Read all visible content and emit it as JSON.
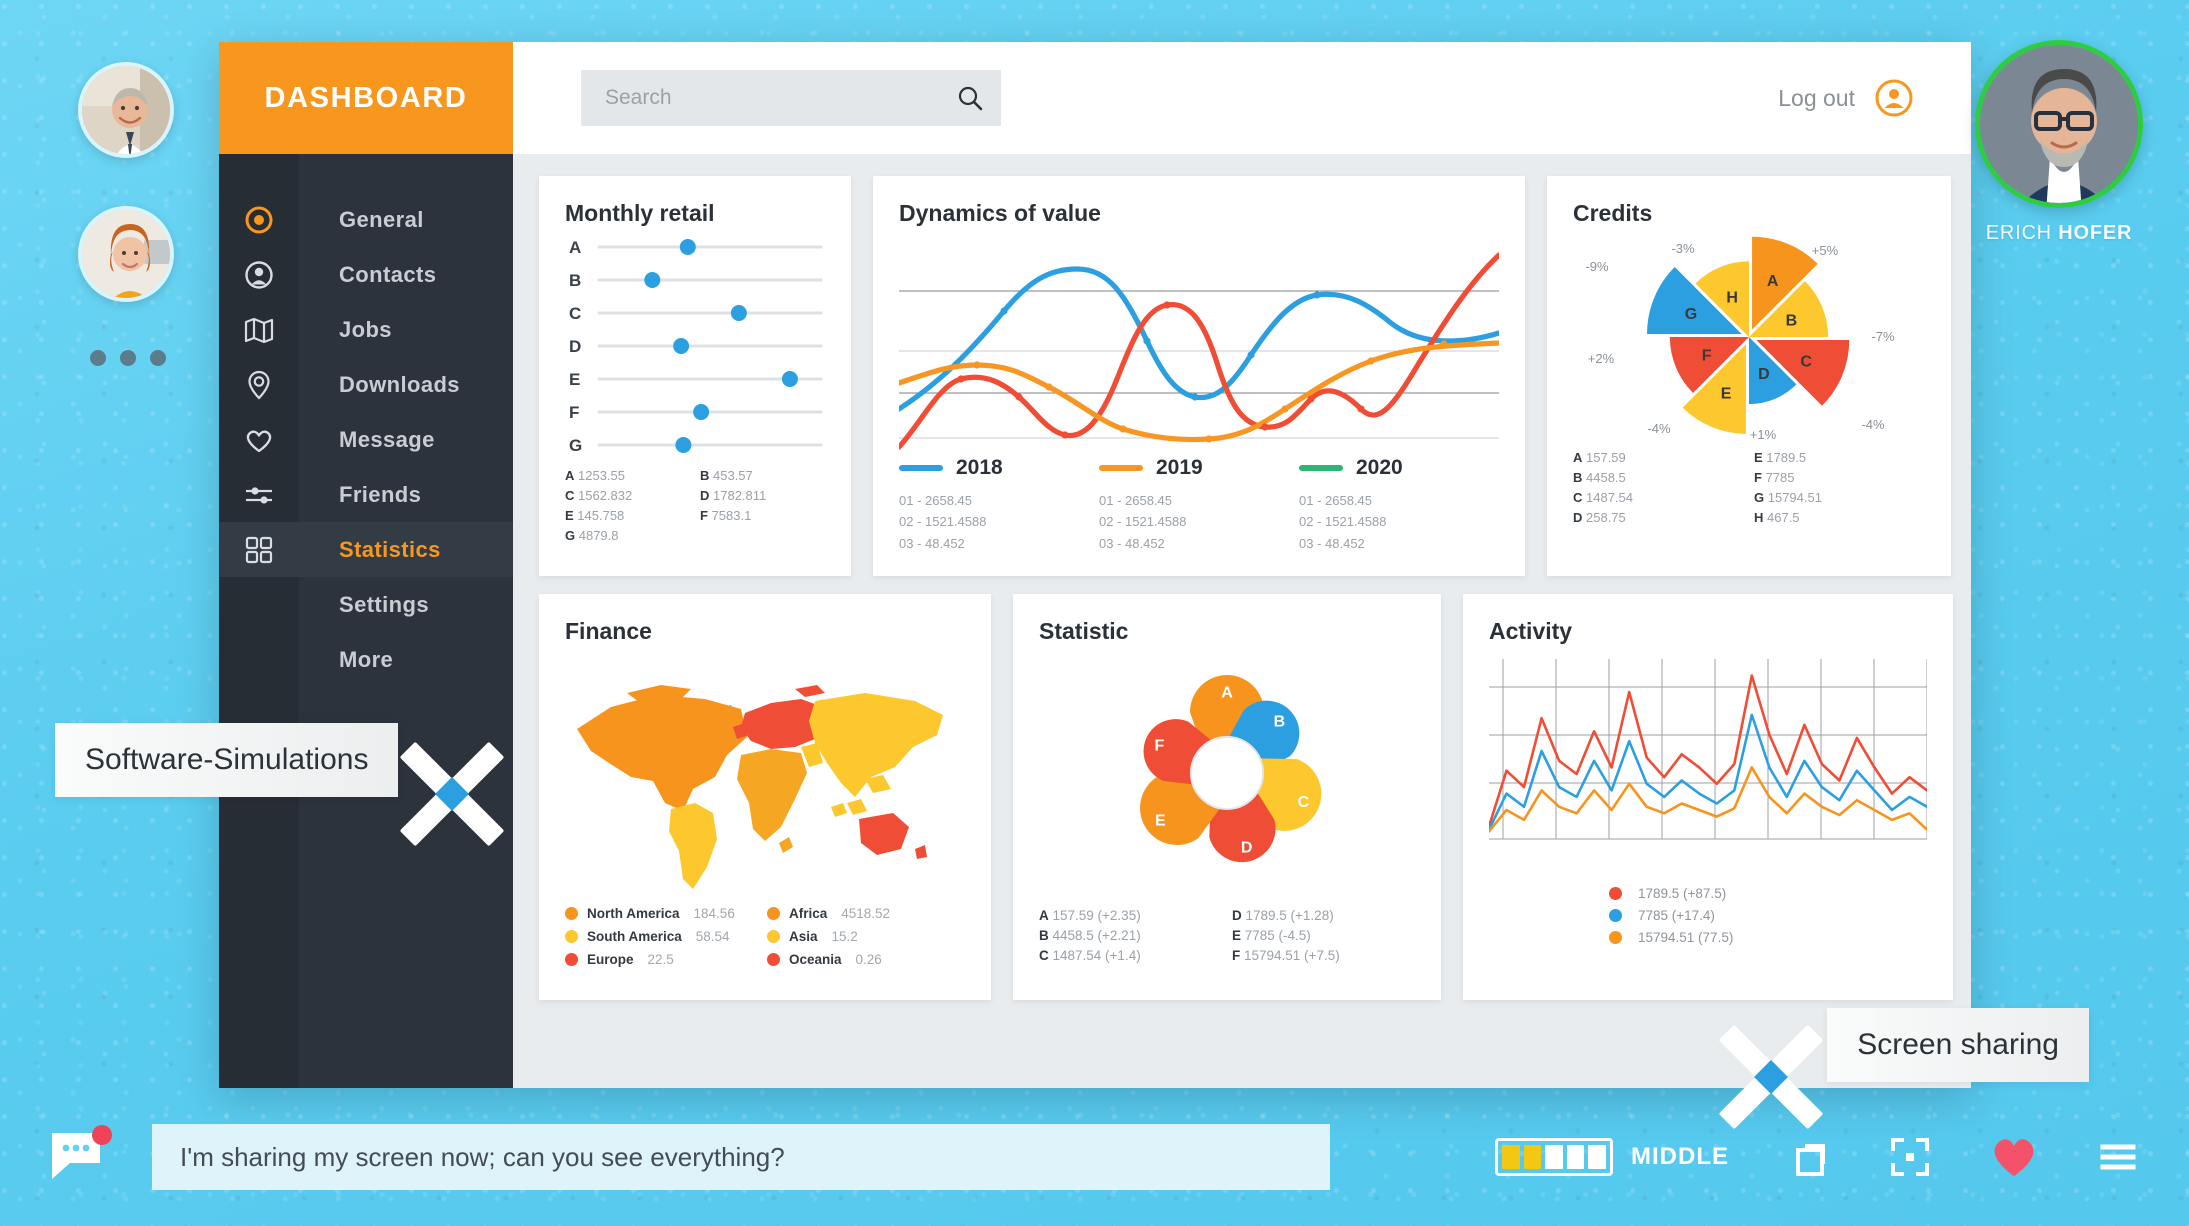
{
  "brand": {
    "title": "DASHBOARD"
  },
  "search": {
    "placeholder": "Search",
    "value": "",
    "icon": "search-icon"
  },
  "header": {
    "logout_label": "Log out",
    "user_icon": "user-circle-icon"
  },
  "sidebar": {
    "items": [
      {
        "label": "General",
        "icon": "target-icon",
        "active": false
      },
      {
        "label": "Contacts",
        "icon": "contact-icon",
        "active": false
      },
      {
        "label": "Jobs",
        "icon": "map-icon",
        "active": false
      },
      {
        "label": "Downloads",
        "icon": "pin-icon",
        "active": false
      },
      {
        "label": "Message",
        "icon": "heart-icon",
        "active": false
      },
      {
        "label": "Friends",
        "icon": "slider-icon",
        "active": false
      },
      {
        "label": "Statistics",
        "icon": "grid-icon",
        "active": true
      },
      {
        "label": "Settings",
        "icon": "",
        "active": false
      },
      {
        "label": "More",
        "icon": "",
        "active": false
      }
    ]
  },
  "participants": {
    "avatars": [
      {
        "name": "participant-1"
      },
      {
        "name": "participant-2"
      }
    ],
    "more_dots": 3
  },
  "speaker": {
    "first_name": "ERICH",
    "last_name": "HOFER",
    "ring_color": "#2ecc40"
  },
  "annotations": [
    {
      "label": "Software-Simulations"
    },
    {
      "label": "Screen sharing"
    }
  ],
  "chat": {
    "message": "I'm sharing my screen now; can you see everything?",
    "badge": true
  },
  "controls": {
    "quality_label": "MIDDLE",
    "quality_filled": 2,
    "quality_total": 5,
    "buttons": [
      {
        "name": "windows-icon"
      },
      {
        "name": "fullscreen-icon"
      },
      {
        "name": "heart-icon"
      },
      {
        "name": "menu-icon"
      }
    ]
  },
  "colors": {
    "accent": "#f8971d",
    "blue": "#2c9fe0",
    "orange": "#f79622",
    "red": "#ef4d35",
    "yellow": "#fdc72e",
    "green": "#2ecc40",
    "dark": "#2c333c"
  },
  "chart_data": [
    {
      "id": "monthly-retail",
      "type": "scatter",
      "title": "Monthly retail",
      "categories": [
        "A",
        "B",
        "C",
        "D",
        "E",
        "F",
        "G"
      ],
      "positions_pct": [
        40,
        24,
        63,
        37,
        86,
        46,
        38
      ],
      "values": [
        1253.55,
        453.57,
        1562.832,
        1782.811,
        145.758,
        7583.1,
        4879.8
      ],
      "legend": [
        {
          "key": "A",
          "value": "1253.55"
        },
        {
          "key": "B",
          "value": "453.57"
        },
        {
          "key": "C",
          "value": "1562.832"
        },
        {
          "key": "D",
          "value": "1782.811"
        },
        {
          "key": "E",
          "value": "145.758"
        },
        {
          "key": "F",
          "value": "7583.1"
        },
        {
          "key": "G",
          "value": "4879.8"
        }
      ],
      "grid": true,
      "xlabel": "",
      "ylabel": ""
    },
    {
      "id": "dynamics-of-value",
      "type": "line",
      "title": "Dynamics of value",
      "series": [
        {
          "name": "2018",
          "color": "#2c9fe0",
          "values": [
            12,
            30,
            62,
            83,
            88,
            70,
            44,
            22,
            18,
            30,
            52,
            71,
            74,
            70,
            60,
            57
          ],
          "points": [
            "01 - 2658.45",
            "02 - 1521.4588",
            "03 - 48.452"
          ]
        },
        {
          "name": "2019",
          "color": "#f79622",
          "values": [
            45,
            52,
            53,
            50,
            44,
            35,
            26,
            14,
            10,
            12,
            18,
            30,
            43,
            50,
            53,
            54
          ],
          "points": [
            "01 - 2658.45",
            "02 - 1521.4588",
            "03 - 48.452"
          ]
        },
        {
          "name": "2020",
          "color": "#2bb673",
          "values": [],
          "points": [
            "01 - 2658.45",
            "02 - 1521.4588",
            "03 - 48.452"
          ]
        }
      ],
      "extra_series": {
        "name": "red-trend",
        "color": "#ef4d35",
        "values": [
          2,
          24,
          47,
          50,
          36,
          22,
          20,
          36,
          68,
          80,
          76,
          44,
          18,
          16,
          26,
          52,
          95
        ]
      },
      "grid": true,
      "legend_position": "bottom"
    },
    {
      "id": "credits",
      "type": "pie",
      "title": "Credits",
      "slices": [
        {
          "key": "A",
          "pct_label": "+5%",
          "value": "157.59",
          "color": "#f7941e",
          "exploded": true,
          "radius": 108
        },
        {
          "key": "B",
          "pct_label": "-7%",
          "value": "4458.5",
          "color": "#fdc72e",
          "exploded": false,
          "radius": 92
        },
        {
          "key": "C",
          "pct_label": "-4%",
          "value": "1487.54",
          "color": "#ef4d35",
          "exploded": true,
          "radius": 108
        },
        {
          "key": "D",
          "pct_label": "+1%",
          "value": "258.75",
          "color": "#2c9fe0",
          "exploded": false,
          "radius": 78
        },
        {
          "key": "E",
          "pct_label": "-4%",
          "value": "1789.5",
          "color": "#fdc72e",
          "exploded": true,
          "radius": 104
        },
        {
          "key": "F",
          "pct_label": "+2%",
          "value": "7785",
          "color": "#ef4d35",
          "exploded": false,
          "radius": 92
        },
        {
          "key": "G",
          "pct_label": "-9%",
          "value": "15794.51",
          "color": "#2c9fe0",
          "exploded": true,
          "radius": 110
        },
        {
          "key": "H",
          "pct_label": "-3%",
          "value": "467.5",
          "color": "#fdc72e",
          "exploded": false,
          "radius": 88
        }
      ]
    },
    {
      "id": "finance",
      "type": "map",
      "title": "Finance",
      "regions": [
        {
          "name": "North America",
          "value": "184.56",
          "color": "#f7941e"
        },
        {
          "name": "South America",
          "value": "58.54",
          "color": "#fdc72e"
        },
        {
          "name": "Europe",
          "value": "22.5",
          "color": "#ef4d35"
        },
        {
          "name": "Africa",
          "value": "4518.52",
          "color": "#f7941e"
        },
        {
          "name": "Asia",
          "value": "15.2",
          "color": "#fdc72e"
        },
        {
          "name": "Oceania",
          "value": "0.26",
          "color": "#ef4d35"
        }
      ]
    },
    {
      "id": "statistic",
      "type": "pie",
      "title": "Statistic",
      "nodes": [
        {
          "key": "A",
          "value": "157.59",
          "delta": "(+2.35)",
          "color": "#f7941e",
          "angle": -90,
          "size": 1.0
        },
        {
          "key": "B",
          "value": "4458.5",
          "delta": "(+2.21)",
          "color": "#2c9fe0",
          "angle": -45,
          "size": 0.8
        },
        {
          "key": "C",
          "value": "1487.54",
          "delta": "(+1.4)",
          "color": "#fdc72e",
          "angle": 20,
          "size": 1.0
        },
        {
          "key": "D",
          "value": "1789.5",
          "delta": "(+1.28)",
          "color": "#ef4d35",
          "angle": 75,
          "size": 0.85
        },
        {
          "key": "E",
          "value": "7785",
          "delta": "(-4.5)",
          "color": "#f7941e",
          "angle": 145,
          "size": 1.0
        },
        {
          "key": "F",
          "value": "15794.51",
          "delta": "(+7.5)",
          "color": "#ef4d35",
          "angle": -157,
          "size": 0.78
        }
      ],
      "legend": [
        {
          "key": "A",
          "text": "157.59 (+2.35)"
        },
        {
          "key": "B",
          "text": "4458.5 (+2.21)"
        },
        {
          "key": "C",
          "text": "1487.54 (+1.4)"
        },
        {
          "key": "D",
          "text": "1789.5 (+1.28)"
        },
        {
          "key": "E",
          "text": "7785 (-4.5)"
        },
        {
          "key": "F",
          "text": "15794.51 (+7.5)"
        }
      ]
    },
    {
      "id": "activity",
      "type": "line",
      "title": "Activity",
      "grid": true,
      "series": [
        {
          "name": "1789.5",
          "delta": "(+87.5)",
          "color": "#ef4d35",
          "values": [
            4,
            38,
            28,
            70,
            44,
            36,
            62,
            40,
            86,
            46,
            34,
            48,
            40,
            30,
            42,
            96,
            60,
            36,
            66,
            42,
            32,
            58,
            40,
            24,
            34,
            26
          ]
        },
        {
          "name": "7785",
          "delta": "(+17.4)",
          "color": "#2c9fe0",
          "values": [
            2,
            24,
            16,
            50,
            28,
            22,
            44,
            26,
            56,
            30,
            22,
            32,
            24,
            18,
            26,
            72,
            40,
            22,
            44,
            28,
            20,
            38,
            26,
            14,
            22,
            16
          ]
        },
        {
          "name": "15794.51",
          "delta": "(77.5)",
          "color": "#f7941e",
          "values": [
            1,
            14,
            8,
            26,
            16,
            12,
            26,
            14,
            30,
            16,
            12,
            18,
            14,
            10,
            15,
            40,
            22,
            12,
            24,
            16,
            11,
            20,
            14,
            8,
            12,
            2
          ]
        }
      ],
      "legend": [
        {
          "text": "1789.5  (+87.5)",
          "color": "#ef4d35"
        },
        {
          "text": "7785 (+17.4)",
          "color": "#2c9fe0"
        },
        {
          "text": "15794.51 (77.5)",
          "color": "#f7941e"
        }
      ]
    }
  ]
}
